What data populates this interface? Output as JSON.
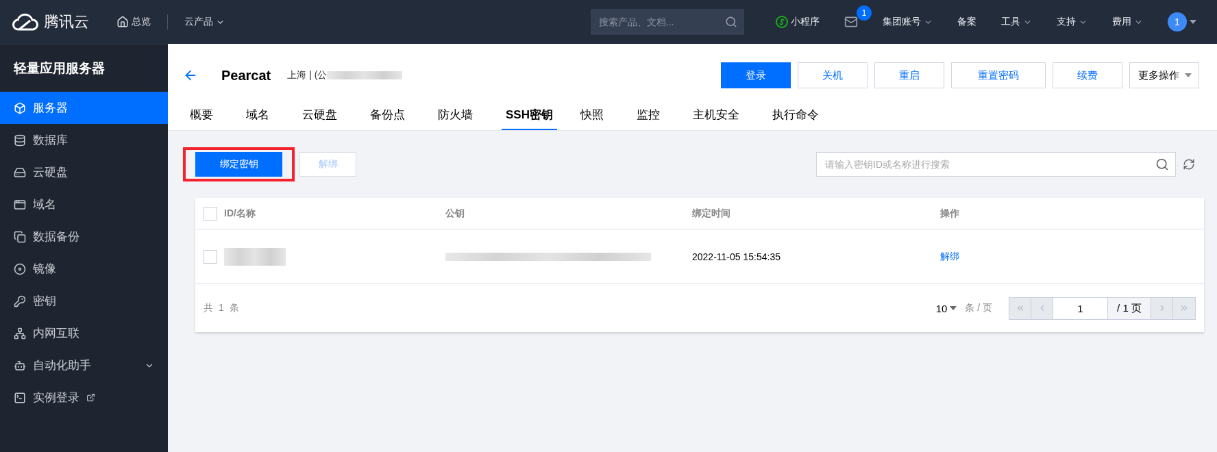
{
  "topbar": {
    "brand": "腾讯云",
    "home": "总览",
    "products": "云产品",
    "search": {
      "placeholder": "搜索产品、文档..."
    },
    "miniprogram": "小程序",
    "mail_badge": "1",
    "menus": [
      {
        "label": "集团账号",
        "has_menu": true
      },
      {
        "label": "备案",
        "has_menu": false
      },
      {
        "label": "工具",
        "has_menu": true
      },
      {
        "label": "支持",
        "has_menu": true
      },
      {
        "label": "费用",
        "has_menu": true
      }
    ],
    "avatar": "1"
  },
  "sidebar": {
    "title": "轻量应用服务器",
    "items": [
      {
        "label": "服务器",
        "selected": true
      },
      {
        "label": "数据库",
        "selected": false
      },
      {
        "label": "云硬盘",
        "selected": false
      },
      {
        "label": "域名",
        "selected": false
      },
      {
        "label": "数据备份",
        "selected": false
      },
      {
        "label": "镜像",
        "selected": false
      },
      {
        "label": "密钥",
        "selected": false
      },
      {
        "label": "内网互联",
        "selected": false
      },
      {
        "label": "自动化助手",
        "selected": false,
        "expandable": true
      },
      {
        "label": "实例登录",
        "selected": false,
        "external": true
      }
    ]
  },
  "header": {
    "title": "Pearcat",
    "region": "上海 | (公",
    "actions": [
      {
        "label": "登录",
        "primary": true
      },
      {
        "label": "关机",
        "primary": false
      },
      {
        "label": "重启",
        "primary": false
      },
      {
        "label": "重置密码",
        "primary": false
      },
      {
        "label": "续费",
        "primary": false
      }
    ],
    "more": "更多操作"
  },
  "tabs": [
    {
      "label": "概要",
      "selected": false
    },
    {
      "label": "域名",
      "selected": false
    },
    {
      "label": "云硬盘",
      "selected": false
    },
    {
      "label": "备份点",
      "selected": false
    },
    {
      "label": "防火墙",
      "selected": false
    },
    {
      "label": "SSH密钥",
      "selected": true
    },
    {
      "label": "快照",
      "selected": false
    },
    {
      "label": "监控",
      "selected": false
    },
    {
      "label": "主机安全",
      "selected": false
    },
    {
      "label": "执行命令",
      "selected": false
    }
  ],
  "toolbar": {
    "bind": {
      "label": "绑定密钥",
      "highlighted": true
    },
    "unbind": {
      "label": "解绑",
      "disabled": true
    },
    "search": {
      "placeholder": "请输入密钥ID或名称进行搜索"
    }
  },
  "table": {
    "all_checked": false,
    "columns": [
      "ID/名称",
      "公钥",
      "绑定时间",
      "操作"
    ],
    "rows": [
      {
        "checked": false,
        "bound_time": "2022-11-05 15:54:35",
        "action": "解绑"
      }
    ]
  },
  "footer": {
    "total": "共 1 条",
    "page_size": "10",
    "per_page": "条 / 页",
    "page": "1",
    "page_total": "/ 1 页"
  }
}
